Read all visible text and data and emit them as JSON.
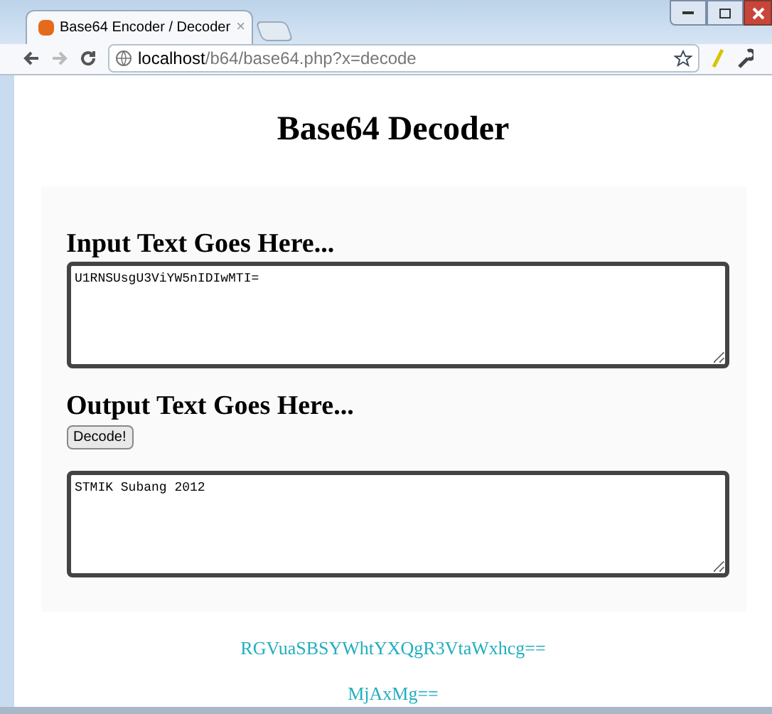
{
  "tab": {
    "title": "Base64 Encoder / Decoder",
    "close": "×"
  },
  "address_bar": {
    "host": "localhost",
    "path": "/b64/base64.php?x=decode"
  },
  "page": {
    "title": "Base64 Decoder",
    "input_label": "Input Text Goes Here...",
    "input_value": "U1RNSUsgU3ViYW5nIDIwMTI=",
    "output_label": "Output Text Goes Here...",
    "decode_button": "Decode!",
    "output_value": "STMIK Subang 2012",
    "footer_lines": [
      "RGVuaSBSYWhtYXQgR3VtaWxhcg==",
      "MjAxMg=="
    ]
  }
}
